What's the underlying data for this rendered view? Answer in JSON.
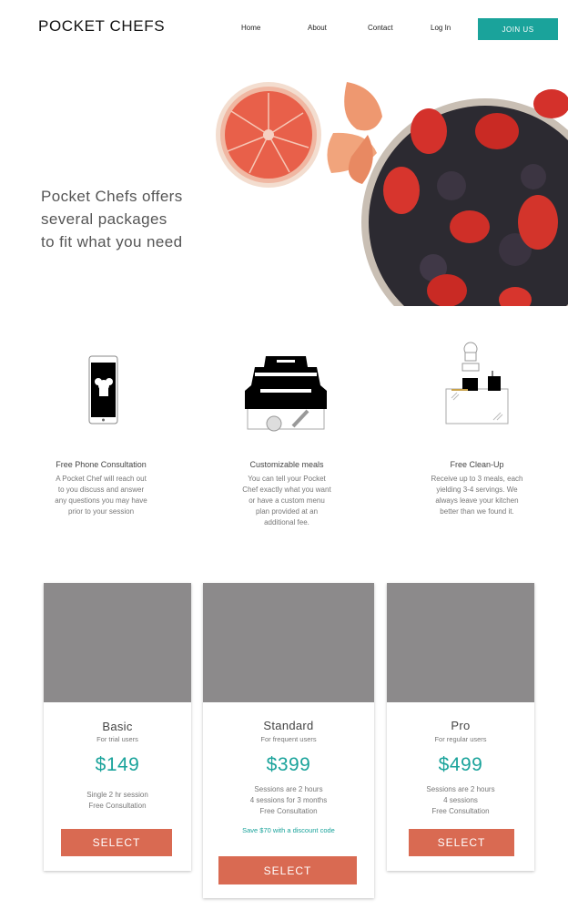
{
  "header": {
    "logo": "POCKET CHEFS",
    "nav": [
      "Home",
      "About",
      "Contact",
      "Log In"
    ],
    "join_label": "JOIN US"
  },
  "hero": {
    "line1": "Pocket Chefs offers",
    "line2": "several packages",
    "line3": "to fit what you need"
  },
  "features": [
    {
      "title": "Free Phone Consultation",
      "lines": [
        "A Pocket Chef will reach out",
        "to you discuss and answer",
        "any questions you may have",
        "prior to your session"
      ]
    },
    {
      "title": "Customizable meals",
      "lines": [
        "You can tell your Pocket",
        "Chef exactly what you want",
        "or have a custom menu",
        "plan provided at an",
        "additional fee."
      ]
    },
    {
      "title": "Free Clean-Up",
      "lines": [
        "Receive up to 3 meals, each",
        "yielding 3-4 servings. We",
        "always leave your kitchen",
        "better than we found it."
      ]
    }
  ],
  "plans": [
    {
      "name": "Basic",
      "audience": "For trial users",
      "price": "$149",
      "features": [
        "Single 2 hr session",
        "Free Consultation"
      ],
      "select_label": "SELECT"
    },
    {
      "name": "Standard",
      "audience": "For frequent users",
      "price": "$399",
      "features": [
        "Sessions are 2 hours",
        "4 sessions for 3 months",
        "Free Consultation"
      ],
      "discount": "Save $70 with a discount code",
      "select_label": "SELECT"
    },
    {
      "name": "Pro",
      "audience": "For regular users",
      "price": "$499",
      "features": [
        "Sessions are 2 hours",
        "4 sessions",
        "Free Consultation"
      ],
      "select_label": "SELECT"
    }
  ],
  "colors": {
    "accent": "#1aa39b",
    "select": "#d96a52",
    "placeholder": "#8c8a8b"
  },
  "icons": [
    "phone-chef-icon",
    "serving-dish-icon",
    "chef-kitchen-icon"
  ]
}
